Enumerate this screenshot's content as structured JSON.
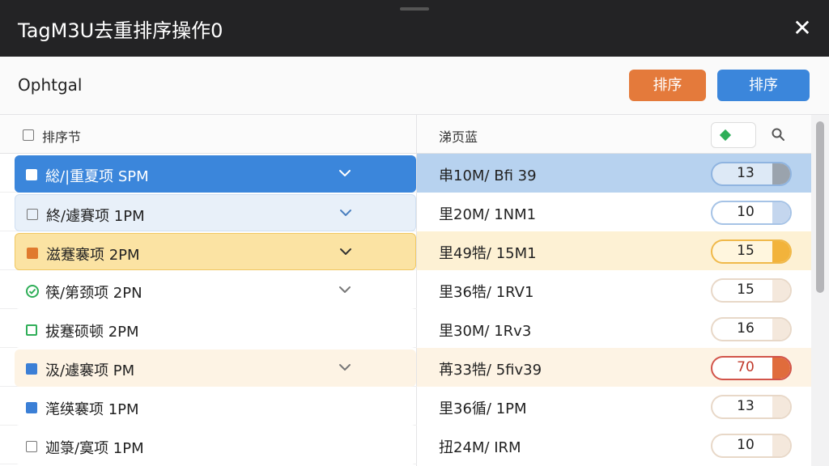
{
  "window": {
    "title": "TagM3U去重排序操作0"
  },
  "toolbar": {
    "option_label": "Ophtgal",
    "btn_sort_orange": "排序",
    "btn_sort_blue": "排序"
  },
  "table": {
    "header": {
      "col1": "排序节",
      "col2": "涕页蓝"
    },
    "rows": [
      {
        "label": "総/|重夏项 SPM",
        "col2": "串10M/ Bfi 39",
        "count": "13",
        "box": "filled-white",
        "chev": true,
        "theme": "selected-blue"
      },
      {
        "label": "終/遽賽项 1PM",
        "col2": "里20M/ 1NM1",
        "count": "10",
        "box": "empty",
        "chev": true,
        "theme": "light-blue"
      },
      {
        "label": "滋蹇褰项 2PM",
        "col2": "里49牿/ 15M1",
        "count": "15",
        "box": "orange",
        "chev": true,
        "theme": "yellow"
      },
      {
        "label": "筷/第颈项 2PN",
        "col2": "里36牿/ 1RV1",
        "count": "15",
        "box": "check-green",
        "chev": true,
        "theme": "white"
      },
      {
        "label": "拔蹇硕顿 2PM",
        "col2": "里30M/ 1Rv3",
        "count": "16",
        "box": "green-empty",
        "chev": false,
        "theme": "white"
      },
      {
        "label": "汲/遽褰项 PM",
        "col2": "苒33牿/ 5fiv39",
        "count": "70",
        "box": "blue",
        "chev": true,
        "theme": "cream"
      },
      {
        "label": "滗绬褰项 1PM",
        "col2": "里36循/ 1PM",
        "count": "13",
        "box": "blue",
        "chev": false,
        "theme": "white"
      },
      {
        "label": "迦箓/寞项 1PM",
        "col2": "扭24M/ IRM",
        "count": "10",
        "box": "empty",
        "chev": false,
        "theme": "white"
      }
    ]
  },
  "icons": {
    "close": "close-icon",
    "search": "search-icon",
    "filter": "filter-diamond-icon",
    "chevron": "chevron-down-icon",
    "check": "check-circle-icon"
  },
  "colors": {
    "selected_blue": "#3b86db",
    "light_blue_bg": "#e8f0f9",
    "yellow_bg": "#fbe3a3",
    "cream_bg": "#fdf3e4",
    "orange": "#e47a3b",
    "red": "#d2544a",
    "green": "#2fae58"
  }
}
